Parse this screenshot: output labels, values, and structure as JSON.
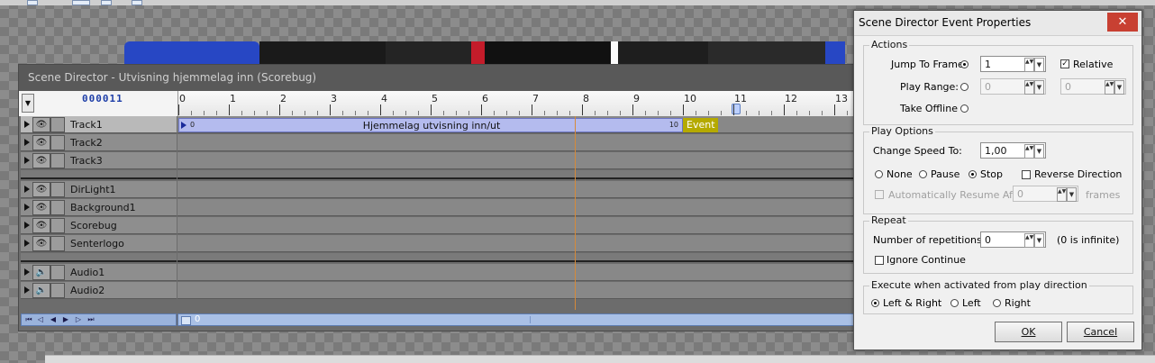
{
  "scene_director": {
    "title": "Scene Director - Utvisning hjemmelag inn (Scorebug)",
    "frame_counter": "000011",
    "ruler_labels": [
      "0",
      "1",
      "2",
      "3",
      "4",
      "5",
      "6",
      "7",
      "8",
      "9",
      "10",
      "11",
      "12",
      "13"
    ],
    "current_frame": 11,
    "track_groups": [
      {
        "tracks": [
          {
            "name": "Track1",
            "icon": "eye-icon",
            "selected": true
          },
          {
            "name": "Track2",
            "icon": "eye-icon"
          },
          {
            "name": "Track3",
            "icon": "eye-icon"
          }
        ]
      },
      {
        "tracks": [
          {
            "name": "DirLight1",
            "icon": "eye-icon"
          },
          {
            "name": "Background1",
            "icon": "eye-icon"
          },
          {
            "name": "Scorebug",
            "icon": "eye-icon"
          },
          {
            "name": "Senterlogo",
            "icon": "eye-icon"
          }
        ]
      },
      {
        "tracks": [
          {
            "name": "Audio1",
            "icon": "speaker-icon"
          },
          {
            "name": "Audio2",
            "icon": "speaker-icon"
          }
        ]
      }
    ],
    "clip": {
      "start": "0",
      "label": "Hjemmelag utvisning inn/ut",
      "end": "10"
    },
    "event_label": "Event",
    "scroll_value": "0"
  },
  "dialog": {
    "title": "Scene Director Event Properties",
    "close_icon": "close-icon",
    "actions": {
      "legend": "Actions",
      "jump_label": "Jump To Frame:",
      "jump_value": "1",
      "relative_label": "Relative",
      "relative_checked": true,
      "play_range_label": "Play Range:",
      "play_range_from": "0",
      "play_range_to": "0",
      "take_offline_label": "Take Offline",
      "selected_action": "jump"
    },
    "play_options": {
      "legend": "Play Options",
      "change_speed_label": "Change Speed To:",
      "speed_value": "1,00",
      "none_label": "None",
      "pause_label": "Pause",
      "stop_label": "Stop",
      "selected": "stop",
      "reverse_label": "Reverse Direction",
      "auto_resume_label": "Automatically Resume After",
      "auto_resume_value": "0",
      "frames_label": "frames"
    },
    "repeat": {
      "legend": "Repeat",
      "reps_label": "Number of repetitions:",
      "reps_value": "0",
      "infinite_note": "(0 is infinite)",
      "ignore_label": "Ignore Continue"
    },
    "execute": {
      "legend": "Execute when activated from play direction",
      "left_right_label": "Left & Right",
      "left_label": "Left",
      "right_label": "Right",
      "selected": "left_right"
    },
    "ok_label": "OK",
    "cancel_label": "Cancel"
  },
  "colors": {
    "clip_fill": "#b4bbee",
    "event_fill": "#b5aa00",
    "close_button": "#c84032",
    "frame_line": "#d58a3a"
  }
}
